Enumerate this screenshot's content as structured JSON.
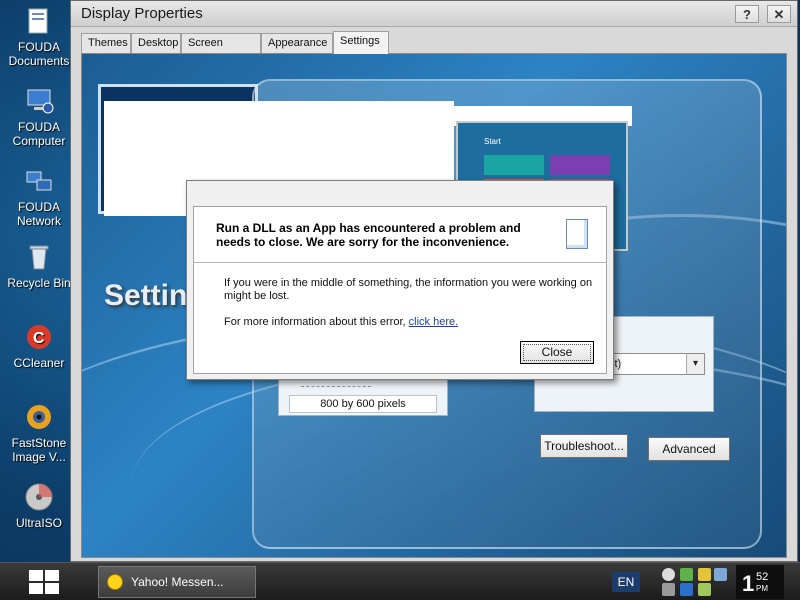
{
  "desktop": {
    "icons": [
      {
        "label": "FOUDA\nDocuments",
        "icon": "folder-documents-icon"
      },
      {
        "label": "FOUDA\nComputer",
        "icon": "computer-icon"
      },
      {
        "label": "FOUDA\nNetwork",
        "icon": "network-icon"
      },
      {
        "label": "Recycle Bin",
        "icon": "recycle-bin-icon"
      },
      {
        "label": "CCleaner",
        "icon": "ccleaner-icon"
      },
      {
        "label": "FastStone\nImage V...",
        "icon": "faststone-icon"
      },
      {
        "label": "UltraISO",
        "icon": "disc-icon"
      }
    ]
  },
  "window": {
    "title": "Display Properties",
    "help_label": "?",
    "close_label": "✕",
    "tabs": [
      {
        "label": "Themes"
      },
      {
        "label": "Desktop"
      },
      {
        "label": "Screen Saver"
      },
      {
        "label": "Appearance"
      },
      {
        "label": "Settings",
        "active": true
      }
    ],
    "settings_heading": "Settings",
    "resolution_text": "800 by 600 pixels",
    "color_quality_partial": "it)",
    "troubleshoot_label": "Troubleshoot...",
    "advanced_label": "Advanced",
    "preview_start_label": "Start"
  },
  "dialog": {
    "heading": "Run a DLL as an App has encountered a problem and needs to close.  We are sorry for the inconvenience.",
    "body_line1": "If you were in the middle of something, the information you were working on might be lost.",
    "body_line2_prefix": "For more information about this error,",
    "link_text": "click here.",
    "close_label": "Close"
  },
  "taskbar": {
    "task_item": "Yahoo! Messen...",
    "language": "EN",
    "clock_hour": "1",
    "clock_minute": "52",
    "clock_ampm": "PM"
  },
  "colors": {
    "desktop_blue": "#0d3f6b",
    "window_gray": "#d9d9d9",
    "link_blue": "#1a3cc8"
  }
}
